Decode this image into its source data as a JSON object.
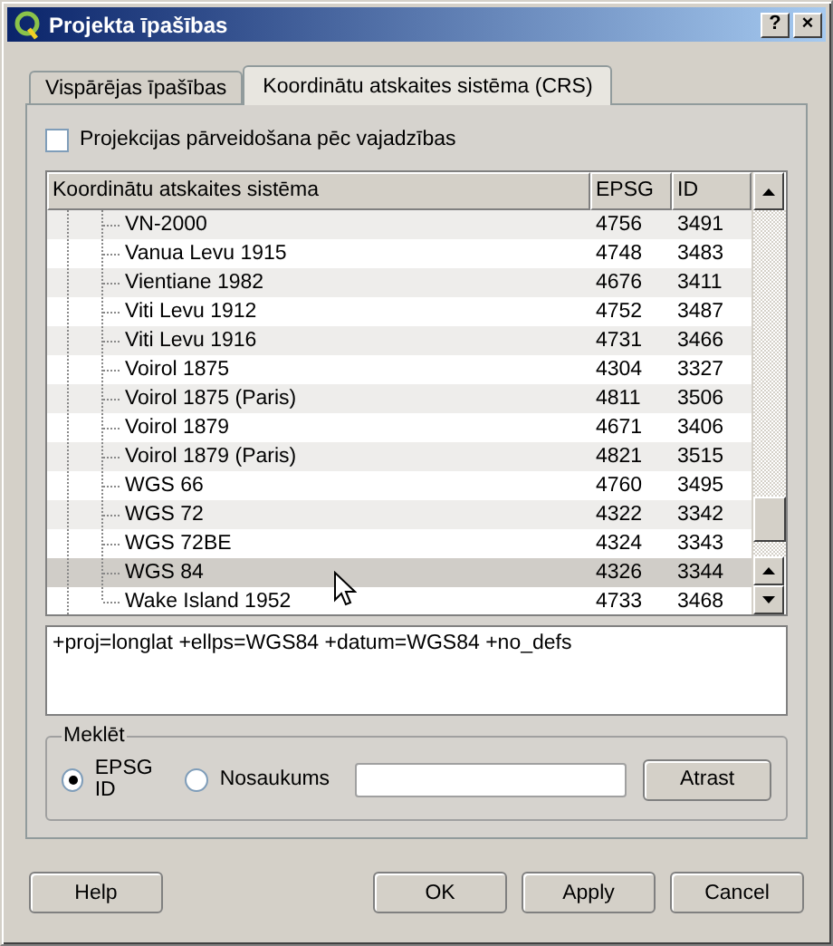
{
  "window": {
    "title": "Projekta īpašības",
    "help_button": "?",
    "close_button": "×"
  },
  "tabs": [
    {
      "label": "Vispārējas īpašības",
      "selected": false
    },
    {
      "label": "Koordinātu atskaites sistēma (CRS)",
      "selected": true
    }
  ],
  "on_the_fly": {
    "label": "Projekcijas pārveidošana pēc vajadzības",
    "checked": false
  },
  "table": {
    "columns": [
      "Koordinātu atskaites sistēma",
      "EPSG",
      "ID"
    ],
    "rows": [
      {
        "name": "VN-2000",
        "epsg": "4756",
        "id": "3491",
        "selected": false
      },
      {
        "name": "Vanua Levu 1915",
        "epsg": "4748",
        "id": "3483",
        "selected": false
      },
      {
        "name": "Vientiane 1982",
        "epsg": "4676",
        "id": "3411",
        "selected": false
      },
      {
        "name": "Viti Levu 1912",
        "epsg": "4752",
        "id": "3487",
        "selected": false
      },
      {
        "name": "Viti Levu 1916",
        "epsg": "4731",
        "id": "3466",
        "selected": false
      },
      {
        "name": "Voirol 1875",
        "epsg": "4304",
        "id": "3327",
        "selected": false
      },
      {
        "name": "Voirol 1875 (Paris)",
        "epsg": "4811",
        "id": "3506",
        "selected": false
      },
      {
        "name": "Voirol 1879",
        "epsg": "4671",
        "id": "3406",
        "selected": false
      },
      {
        "name": "Voirol 1879 (Paris)",
        "epsg": "4821",
        "id": "3515",
        "selected": false
      },
      {
        "name": "WGS 66",
        "epsg": "4760",
        "id": "3495",
        "selected": false
      },
      {
        "name": "WGS 72",
        "epsg": "4322",
        "id": "3342",
        "selected": false
      },
      {
        "name": "WGS 72BE",
        "epsg": "4324",
        "id": "3343",
        "selected": false
      },
      {
        "name": "WGS 84",
        "epsg": "4326",
        "id": "3344",
        "selected": true
      },
      {
        "name": "Wake Island 1952",
        "epsg": "4733",
        "id": "3468",
        "selected": false
      }
    ]
  },
  "proj_string": "+proj=longlat +ellps=WGS84 +datum=WGS84 +no_defs",
  "search": {
    "title": "Meklēt",
    "options": [
      {
        "label": "EPSG ID",
        "selected": true
      },
      {
        "label": "Nosaukums",
        "selected": false
      }
    ],
    "button": "Atrast"
  },
  "buttons": [
    "Help",
    "OK",
    "Apply",
    "Cancel"
  ]
}
